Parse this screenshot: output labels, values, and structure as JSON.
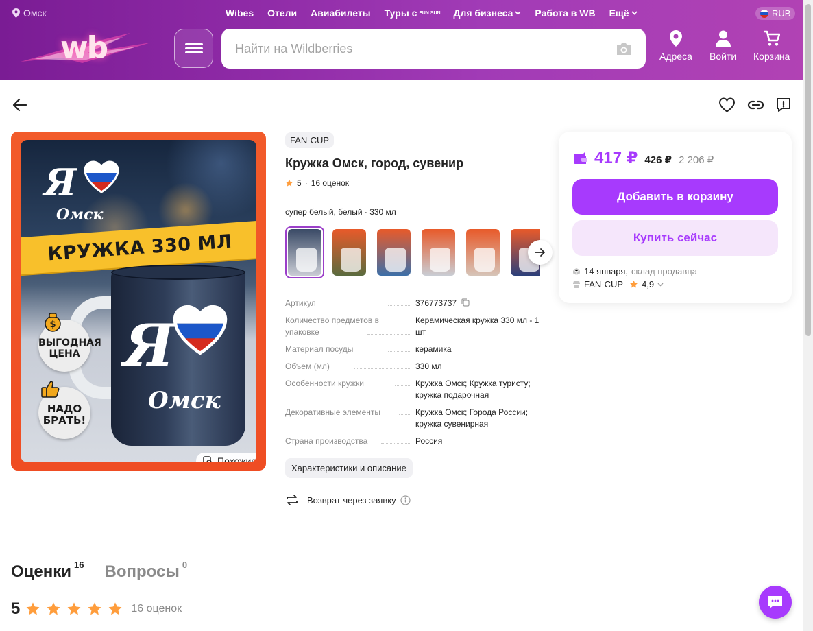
{
  "header": {
    "city": "Омск",
    "nav": [
      "Wibes",
      "Отели",
      "Авиабилеты",
      "Туры с",
      "Для бизнеса",
      "Работа в WB",
      "Ещё"
    ],
    "funsun": "FUN SUN",
    "currency": "RUB",
    "logo": "wb",
    "search_placeholder": "Найти на Wildberries",
    "actions": {
      "addresses": "Адреса",
      "login": "Войти",
      "cart": "Корзина"
    }
  },
  "product": {
    "brand": "FAN-CUP",
    "title": "Кружка Омск, город, сувенир",
    "rating": "5",
    "reviews": "16 оценок",
    "variant": "супер белый, белый · 330 мл",
    "gallery": {
      "ya": "Я",
      "city": "Омск",
      "ribbon": "КРУЖКА 330 МЛ",
      "badge1": "ВЫГОДНАЯ ЦЕНА",
      "badge2": "НАДО БРАТЬ!",
      "similar": "Похожие"
    },
    "thumb_colors": [
      "#3a4a66",
      "#5a6b3e",
      "#3c6fa8",
      "#c9cdd4",
      "#d6c4b8",
      "#2b3f7a"
    ],
    "specs": [
      {
        "name": "Артикул",
        "value": "376773737"
      },
      {
        "name": "Количество предметов в упаковке",
        "value": "Керамическая кружка 330 мл - 1 шт"
      },
      {
        "name": "Материал посуды",
        "value": "керамика"
      },
      {
        "name": "Объем (мл)",
        "value": "330 мл"
      },
      {
        "name": "Особенности кружки",
        "value": "Кружка Омск; Кружка туристу; кружка подарочная"
      },
      {
        "name": "Декоративные элементы",
        "value": "Кружка Омск; Города России; кружка сувенирная"
      },
      {
        "name": "Страна производства",
        "value": "Россия"
      }
    ],
    "characteristics_button": "Характеристики и описание",
    "return_text": "Возврат через заявку"
  },
  "buy": {
    "price": "417 ₽",
    "price_mid": "426 ₽",
    "price_old": "2 206 ₽",
    "add_to_cart": "Добавить в корзину",
    "buy_now": "Купить сейчас",
    "delivery_date": "14 января,",
    "delivery_from": "склад продавца",
    "seller": "FAN-CUP",
    "seller_rating": "4,9"
  },
  "reviews_section": {
    "tab_reviews": "Оценки",
    "tab_reviews_count": "16",
    "tab_questions": "Вопросы",
    "tab_questions_count": "0",
    "score": "5",
    "count": "16 оценок"
  },
  "colors": {
    "accent": "#a73afd",
    "header": "#8e2aa6",
    "star": "#ff9d3c"
  }
}
